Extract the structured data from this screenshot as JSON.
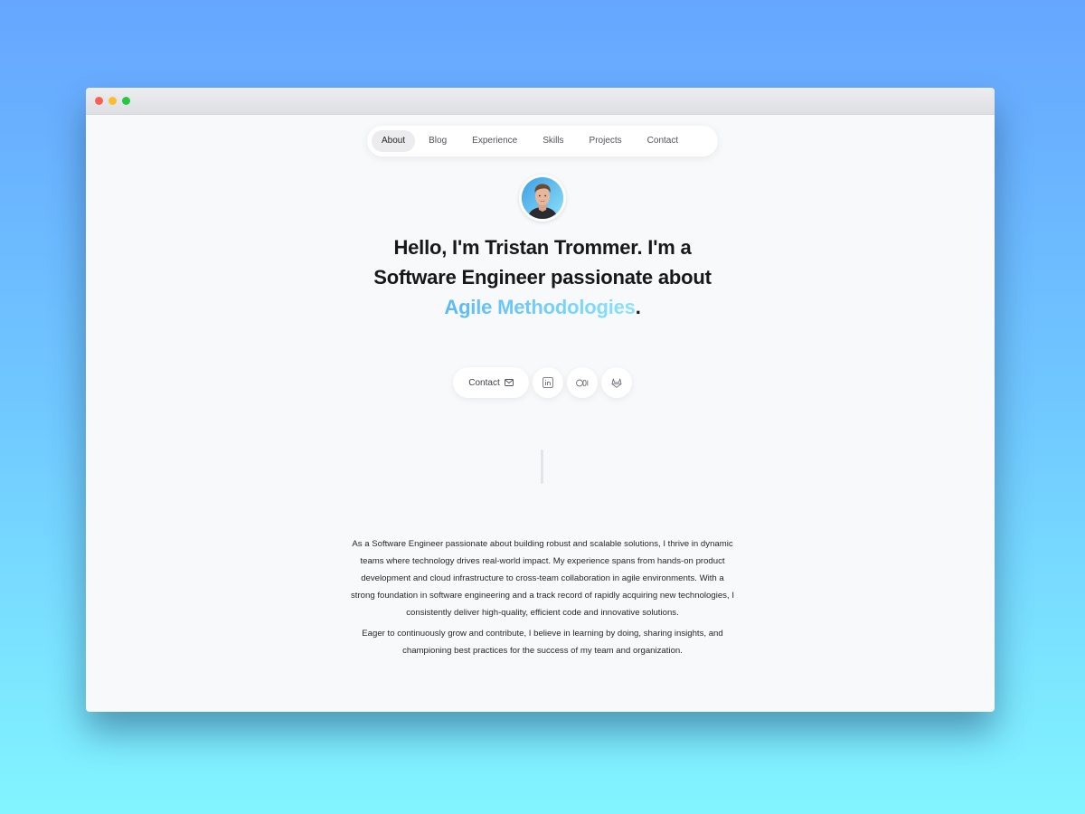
{
  "window": {
    "controls": [
      "close",
      "minimize",
      "maximize"
    ]
  },
  "nav": {
    "items": [
      {
        "label": "About",
        "active": true
      },
      {
        "label": "Blog",
        "active": false
      },
      {
        "label": "Experience",
        "active": false
      },
      {
        "label": "Skills",
        "active": false
      },
      {
        "label": "Projects",
        "active": false
      },
      {
        "label": "Contact",
        "active": false
      }
    ]
  },
  "hero": {
    "greeting": "Hello, I'm ",
    "name": "Tristan Trommer",
    "mid": ". I'm a",
    "role": "Software Engineer",
    "passion_text": " passionate about",
    "passion": "Agile Methodologies",
    "end": "."
  },
  "actions": {
    "contact_label": "Contact",
    "icons": [
      "linkedin-icon",
      "medium-icon",
      "gitlab-icon"
    ]
  },
  "about": {
    "paragraphs": [
      "As a Software Engineer passionate about building robust and scalable solutions, I thrive in dynamic teams where technology drives real-world impact. My experience spans from hands-on product development and cloud infrastructure to cross-team collaboration in agile environments. With a strong foundation in software engineering and a track record of rapidly acquiring new technologies, I consistently deliver high-quality, efficient code and innovative solutions.",
      "Eager to continuously grow and contribute, I believe in learning by doing, sharing insights, and championing best practices for the success of my team and organization."
    ]
  },
  "colors": {
    "accent_start": "#5bb8f5",
    "accent_end": "#8be2ff",
    "background_top": "#66a6ff",
    "background_bottom": "#82f5ff"
  }
}
